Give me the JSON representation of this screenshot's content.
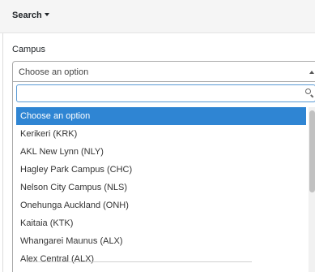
{
  "header": {
    "search_label": "Search"
  },
  "form": {
    "campus_label": "Campus",
    "campus_select_value": "Choose an option",
    "dropdown_search_placeholder": ""
  },
  "dropdown": {
    "options": [
      "Choose an option",
      "Kerikeri (KRK)",
      "AKL New Lynn (NLY)",
      "Hagley Park Campus (CHC)",
      "Nelson City Campus (NLS)",
      "Onehunga Auckland (ONH)",
      "Kaitaia (KTK)",
      "Whangarei Maunus (ALX)",
      "Alex Central (ALX)"
    ],
    "selected_index": 0
  },
  "colors": {
    "highlight": "#2f85d3",
    "focus_border": "#5b9bd5",
    "header_bg": "#f5f5f5"
  }
}
